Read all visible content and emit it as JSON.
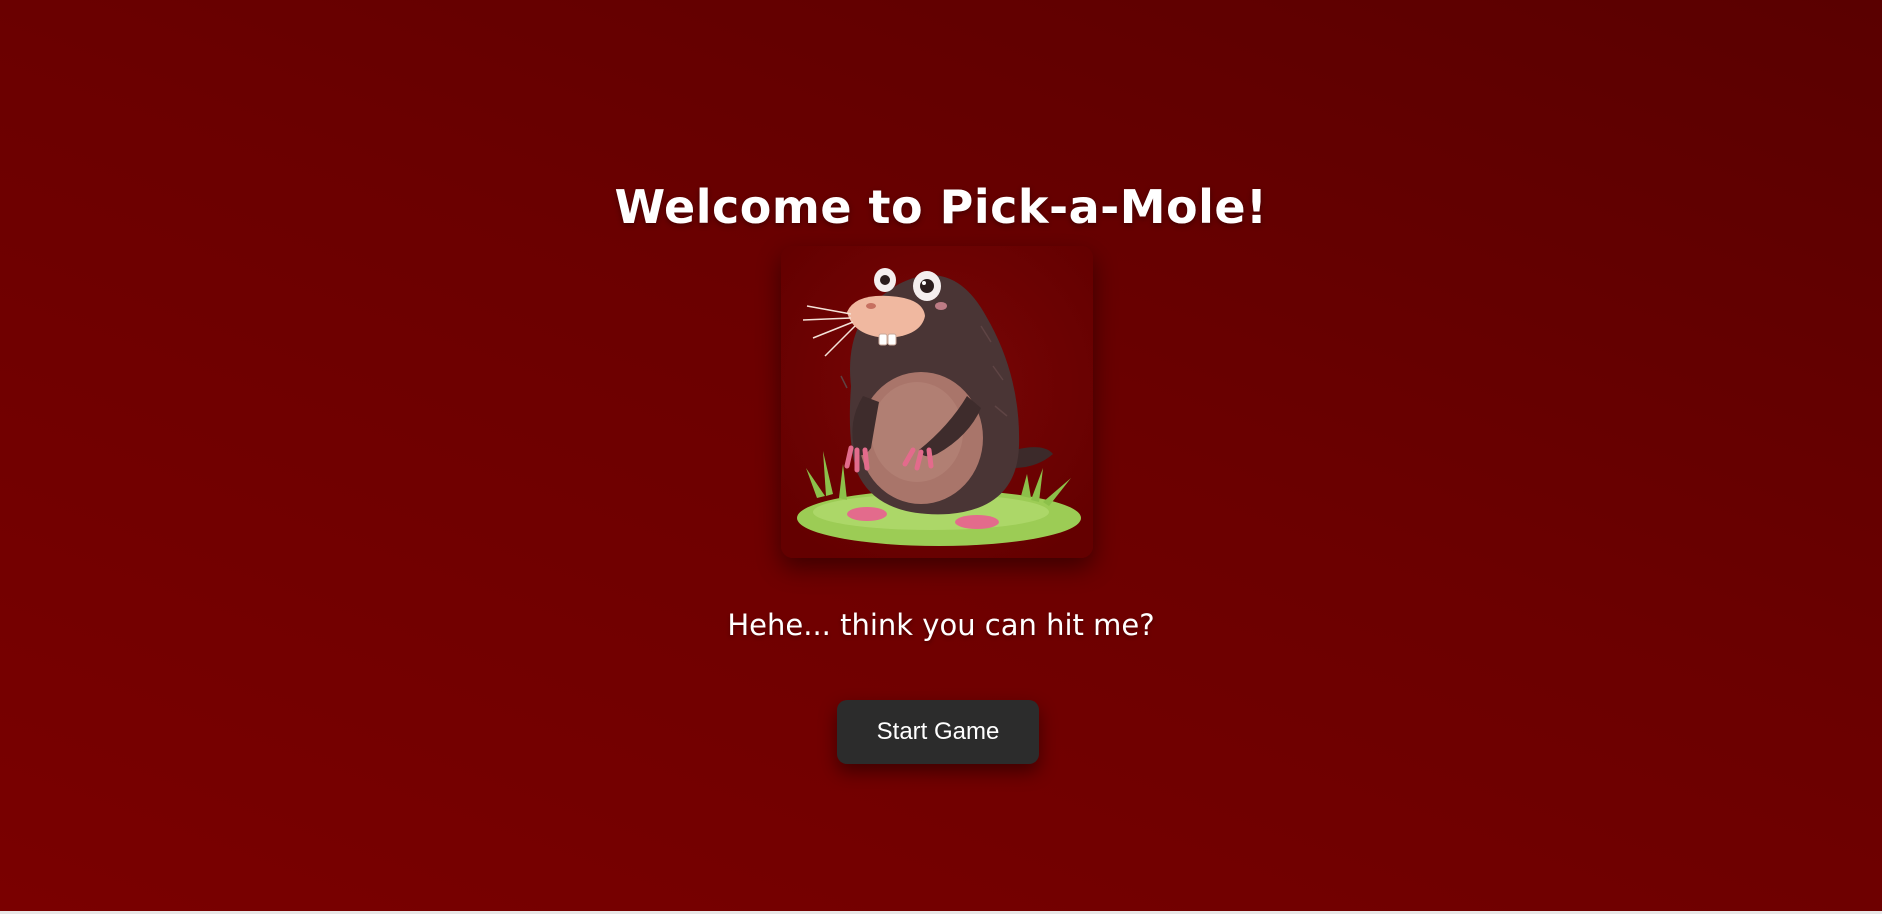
{
  "page": {
    "title": "Welcome to Pick-a-Mole!",
    "taunt": "Hehe... think you can hit me?",
    "start_button_label": "Start Game"
  },
  "mole_image": {
    "icon": "mole-illustration",
    "alt": "Cartoon mole standing on grass"
  },
  "colors": {
    "background": "#6b0000",
    "button": "#2c2c2c",
    "text": "#ffffff",
    "grass": "#9ccc55",
    "mole_body": "#4a3535"
  }
}
